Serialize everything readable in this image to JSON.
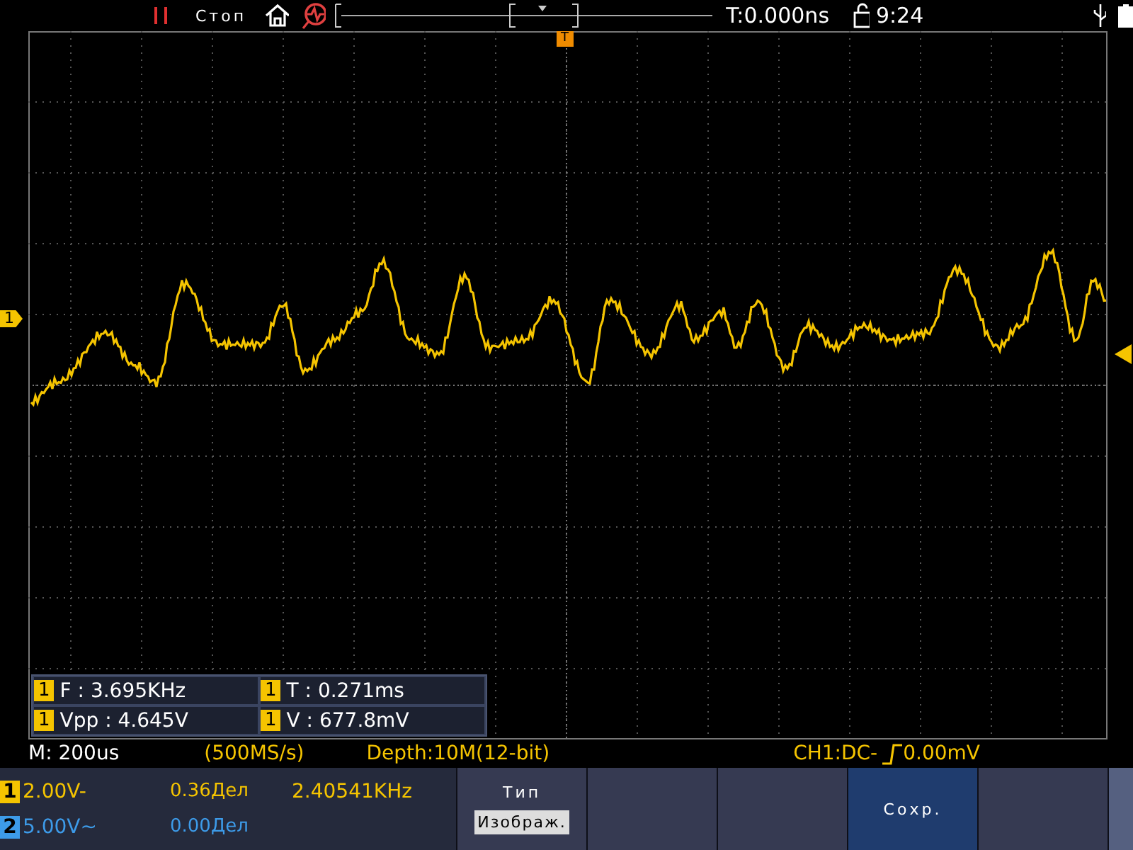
{
  "top_bar": {
    "run_state": "Стоп",
    "trigger_time": "T:0.000ns",
    "clock": "9:24"
  },
  "trigger_marker": "T",
  "channel_marker": "1",
  "measurements": [
    {
      "channel": "1",
      "text": "F : 3.695KHz"
    },
    {
      "channel": "1",
      "text": "T : 0.271ms"
    },
    {
      "channel": "1",
      "text": "Vpp : 4.645V"
    },
    {
      "channel": "1",
      "text": "V : 677.8mV"
    }
  ],
  "status_line": {
    "timebase": "M: 200us",
    "sample_rate": "(500MS/s)",
    "depth": "Depth:10M(12-bit)",
    "trigger_source": "CH1:DC-",
    "trigger_level": "0.00mV"
  },
  "channels": [
    {
      "number": "1",
      "scale": "2.00V-",
      "offset": "0.36Дел",
      "frequency": "2.40541KHz",
      "color": "#f5c400"
    },
    {
      "number": "2",
      "scale": "5.00V~",
      "offset": "0.00Дел",
      "color": "#3d9be9"
    }
  ],
  "soft_keys": [
    {
      "label": "Тип",
      "value": "Изображ.",
      "selected": false
    },
    {
      "selected": false
    },
    {
      "selected": false
    },
    {
      "label": "Сохр.",
      "selected": true
    },
    {
      "selected": false
    }
  ]
}
